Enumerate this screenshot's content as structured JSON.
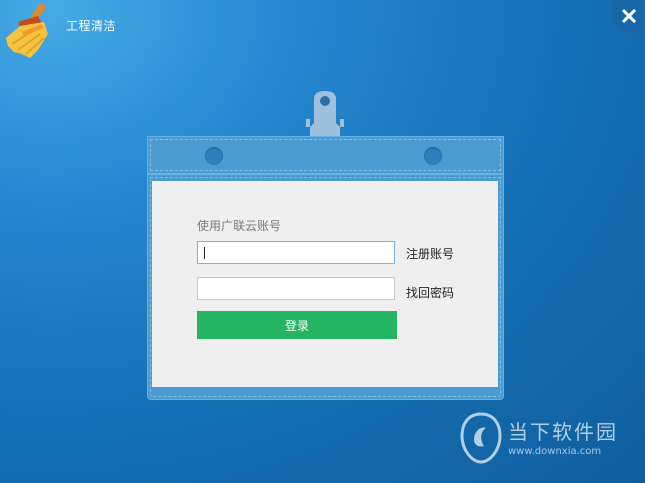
{
  "window": {
    "title": "工程清洁"
  },
  "icons": {
    "app": "broom-icon",
    "close": "close-icon",
    "clip": "badge-clip-icon",
    "watermark": "downxia-logo-icon"
  },
  "login": {
    "account_label": "使用广联云账号",
    "username_value": "",
    "password_value": "",
    "register_label": "注册账号",
    "recover_label": "找回密码",
    "submit_label": "登录"
  },
  "watermark": {
    "brand": "当下软件园",
    "url": "www.downxia.com"
  },
  "colors": {
    "background": "#1a74b8",
    "badge": "#4a9bd2",
    "card": "#efefef",
    "login_button": "#24b462"
  }
}
